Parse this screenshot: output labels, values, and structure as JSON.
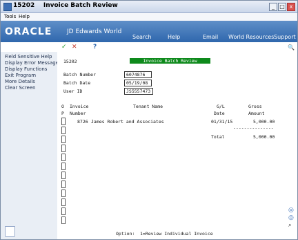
{
  "window": {
    "title": "15202    Invoice Batch Review",
    "buttons": [
      "_",
      "□",
      "x"
    ]
  },
  "menu": [
    "Tools",
    "Help"
  ],
  "banner": {
    "logo": "ORACLE",
    "product": "JD Edwards World",
    "links": [
      "Search",
      "Help",
      "Email",
      "World Resources",
      "Support"
    ]
  },
  "toolbar": {
    "ok_glyph": "✓",
    "cancel_glyph": "✕",
    "help_glyph": "?",
    "search_glyph": "🔍"
  },
  "sidebar": {
    "items": [
      "Field Sensitive Help",
      "Display Error Message",
      "Display Functions",
      "Exit Program",
      "More Details",
      "Clear Screen"
    ]
  },
  "form": {
    "program_id": "15202",
    "screen_title": "Invoice Batch Review",
    "batch_number_label": "Batch Number",
    "batch_number": "6074876",
    "batch_date_label": "Batch Date",
    "batch_date": "05/19/08",
    "user_id_label": "User ID",
    "user_id": "JS5557473",
    "col_o": "O",
    "col_p": "P",
    "col_invoice": "Invoice",
    "col_number": "Number",
    "col_tenant": "Tenant Name",
    "col_gl": "G/L",
    "col_date": "Date",
    "col_gross": "Gross",
    "col_amount": "Amount",
    "rows": [
      {
        "invoice": "8726",
        "tenant": "James Robert and Associates",
        "date": "01/31/15",
        "amount": "5,000.00"
      }
    ],
    "separator": "---------------",
    "total_label": "Total",
    "total": "5,000.00",
    "option_label": "Option:",
    "option_text": "1=Review Individual Invoice"
  }
}
